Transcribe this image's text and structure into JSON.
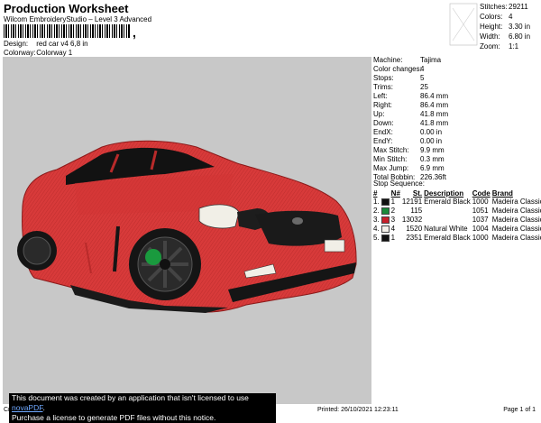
{
  "header": {
    "title": "Production Worksheet",
    "subtitle": "Wilcom EmbroideryStudio – Level 3 Advanced",
    "design_label": "Design:",
    "design_value": "red car v4 6,8 in",
    "colorway_label": "Colorway:",
    "colorway_value": "Colorway 1"
  },
  "stats": [
    {
      "label": "Stitches:",
      "value": "29211"
    },
    {
      "label": "Colors:",
      "value": "4"
    },
    {
      "label": "Height:",
      "value": "3.30 in"
    },
    {
      "label": "Width:",
      "value": "6.80 in"
    },
    {
      "label": "Zoom:",
      "value": "1:1"
    }
  ],
  "machine_params": [
    {
      "label": "Machine:",
      "value": "Tajima"
    },
    {
      "label": "Color changes:",
      "value": "4"
    },
    {
      "label": "Stops:",
      "value": "5"
    },
    {
      "label": "Trims:",
      "value": "25"
    },
    {
      "label": "Left:",
      "value": "86.4 mm"
    },
    {
      "label": "Right:",
      "value": "86.4 mm"
    },
    {
      "label": "Up:",
      "value": "41.8 mm"
    },
    {
      "label": "Down:",
      "value": "41.8 mm"
    },
    {
      "label": "EndX:",
      "value": "0.00 in"
    },
    {
      "label": "EndY:",
      "value": "0.00 in"
    },
    {
      "label": "Max Stitch:",
      "value": "9.9 mm"
    },
    {
      "label": "Min Stitch:",
      "value": "0.3 mm"
    },
    {
      "label": "Max Jump:",
      "value": "6.9 mm"
    },
    {
      "label": "Total Bobbin:",
      "value": "226.36ft"
    }
  ],
  "stop_sequence": {
    "title": "Stop Sequence:",
    "columns": [
      "#",
      "N#",
      "St.",
      "Description",
      "Code",
      "Brand"
    ],
    "rows": [
      {
        "num": "1.",
        "n": "1",
        "color": "#111111",
        "st": "12191",
        "desc": "Emerald Black",
        "code": "1000",
        "brand": "Madeira Classic 40"
      },
      {
        "num": "2.",
        "n": "2",
        "color": "#1a8a3a",
        "st": "115",
        "desc": "",
        "code": "1051",
        "brand": "Madeira Classic 40"
      },
      {
        "num": "3.",
        "n": "3",
        "color": "#c8202a",
        "st": "13032",
        "desc": "",
        "code": "1037",
        "brand": "Madeira Classic 40"
      },
      {
        "num": "4.",
        "n": "4",
        "color": "#f4f1ea",
        "st": "1520",
        "desc": "Natural White",
        "code": "1004",
        "brand": "Madeira Classic 40"
      },
      {
        "num": "5.",
        "n": "1",
        "color": "#111111",
        "st": "2351",
        "desc": "Emerald Black",
        "code": "1000",
        "brand": "Madeira Classic 40"
      }
    ]
  },
  "notice": {
    "line1_prefix": "This document was created by an application that isn't licensed to use ",
    "line1_link": "novaPDF",
    "line1_suffix": ".",
    "line2": "Purchase a license to generate PDF files without this notice."
  },
  "footer": {
    "left": "Cr",
    "printed": "Printed: 26/10/2021 12:23:11",
    "page": "Page 1 of 1"
  }
}
